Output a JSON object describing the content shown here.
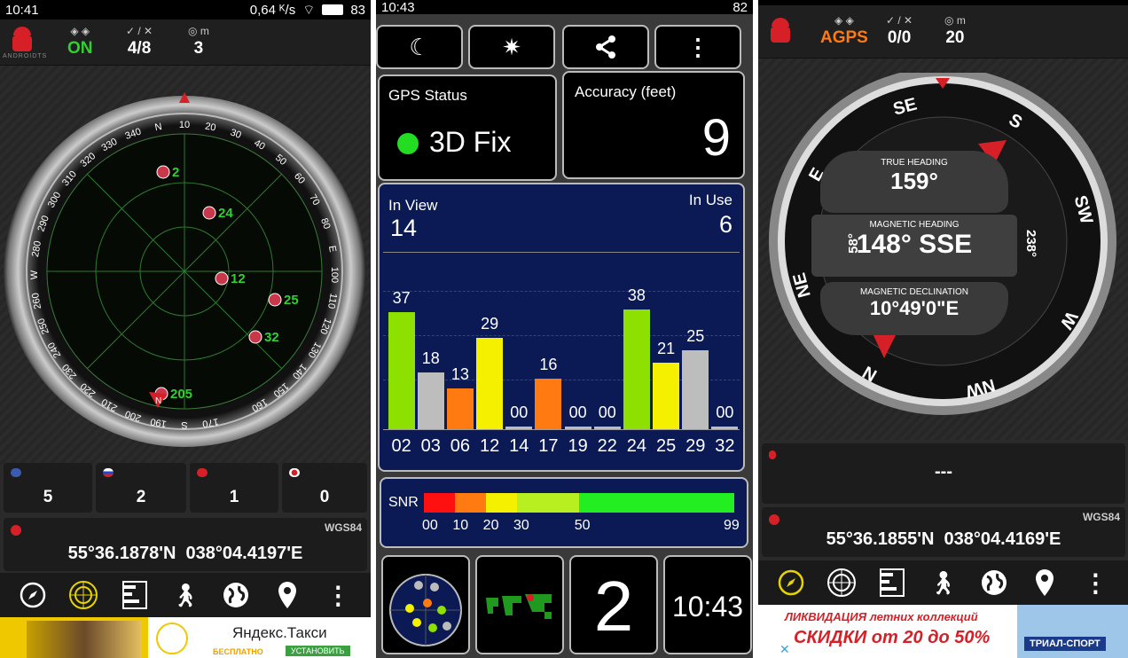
{
  "left": {
    "status": {
      "time": "10:41",
      "battery_speed": "0,64 ᴷ/s",
      "battery": "83"
    },
    "topbar": {
      "brand": "ANDROIDTS",
      "fix_state": "ON",
      "sats": "4/8",
      "accuracy_m": "3",
      "acc_unit": "m"
    },
    "radar": {
      "heading_marker": "N",
      "ring_labels": [
        "170",
        "S",
        "190",
        "200",
        "210",
        "220",
        "230",
        "240",
        "250",
        "260",
        "W",
        "280",
        "290",
        "300",
        "310",
        "320",
        "330",
        "340",
        "N",
        "10",
        "20",
        "30",
        "40",
        "50",
        "60",
        "70",
        "80",
        "E",
        "100",
        "110",
        "120",
        "130",
        "140",
        "150",
        "160"
      ],
      "satellites": [
        {
          "id": "2",
          "flag": "us"
        },
        {
          "id": "24",
          "flag": "us"
        },
        {
          "id": "12",
          "flag": "us"
        },
        {
          "id": "25",
          "flag": "us"
        },
        {
          "id": "32",
          "flag": "us"
        },
        {
          "id": "205",
          "flag": "us"
        }
      ]
    },
    "counts": [
      {
        "flag": "us",
        "value": "5"
      },
      {
        "flag": "ru",
        "value": "2"
      },
      {
        "flag": "cn",
        "value": "1"
      },
      {
        "flag": "jp",
        "value": "0"
      }
    ],
    "coords": {
      "datum": "WGS84",
      "lat": "55°36.1878'N",
      "lon": "038°04.4197'E"
    },
    "nav_icons": [
      "compass-icon",
      "radar-icon",
      "list-icon",
      "walk-icon",
      "globe-icon",
      "pin-icon",
      "more-icon"
    ],
    "ad": {
      "brand": "Яндекс.Такси",
      "sub1": "БЕСПЛАТНО",
      "sub2": "УСТАНОВИТЬ"
    }
  },
  "middle": {
    "status": {
      "time": "10:43",
      "battery": "82"
    },
    "buttons": [
      "moon-icon",
      "sun-icon",
      "share-icon",
      "more-icon"
    ],
    "gps_status": {
      "title": "GPS Status",
      "value": "3D Fix",
      "color": "#22dd22"
    },
    "accuracy": {
      "title": "Accuracy (feet)",
      "value": "9"
    },
    "in_view": {
      "label": "In View",
      "value": "14"
    },
    "in_use": {
      "label": "In Use",
      "value": "6"
    },
    "chart_data": {
      "type": "bar",
      "categories": [
        "02",
        "03",
        "06",
        "12",
        "14",
        "17",
        "19",
        "22",
        "24",
        "25",
        "29",
        "32"
      ],
      "values": [
        37,
        18,
        13,
        29,
        0,
        16,
        0,
        0,
        38,
        21,
        25,
        0
      ],
      "value_labels": [
        "37",
        "18",
        "13",
        "29",
        "00",
        "16",
        "00",
        "00",
        "38",
        "21",
        "25",
        "00"
      ],
      "colors": [
        "#8ee000",
        "#bdbdbd",
        "#ff7a10",
        "#f5f000",
        "#bdbdbd",
        "#ff7a10",
        "#bdbdbd",
        "#bdbdbd",
        "#8ee000",
        "#f5f000",
        "#bdbdbd",
        "#bdbdbd"
      ],
      "ylim": [
        0,
        45
      ]
    },
    "snr": {
      "label": "SNR",
      "ticks": [
        "00",
        "10",
        "20",
        "30",
        "50",
        "99"
      ]
    },
    "tiles": {
      "big_number": "2",
      "clock": "10:43"
    }
  },
  "right": {
    "status": {
      "battery": ""
    },
    "topbar": {
      "mode": "AGPS",
      "sats": "0/0",
      "accuracy_m": "20",
      "acc_unit": "m"
    },
    "compass": {
      "true_heading_label": "TRUE HEADING",
      "true_heading": "159°",
      "mag_heading_label": "MAGNETIC HEADING",
      "mag_heading": "148° SSE",
      "mag_decl_label": "MAGNETIC DECLINATION",
      "mag_decl": "10°49'0\"E",
      "side_left": "58°",
      "side_right": "238°",
      "dirs": [
        "S",
        "SE",
        "E",
        "NE",
        "N",
        "NW",
        "W",
        "SW"
      ]
    },
    "coords_empty": "---",
    "coords": {
      "datum": "WGS84",
      "lat": "55°36.1855'N",
      "lon": "038°04.4169'E"
    },
    "ad": {
      "line1": "ЛИКВИДАЦИЯ летних коллекций",
      "line2": "СКИДКИ от 20 до 50%",
      "brand": "ТРИАЛ-СПОРТ"
    }
  }
}
